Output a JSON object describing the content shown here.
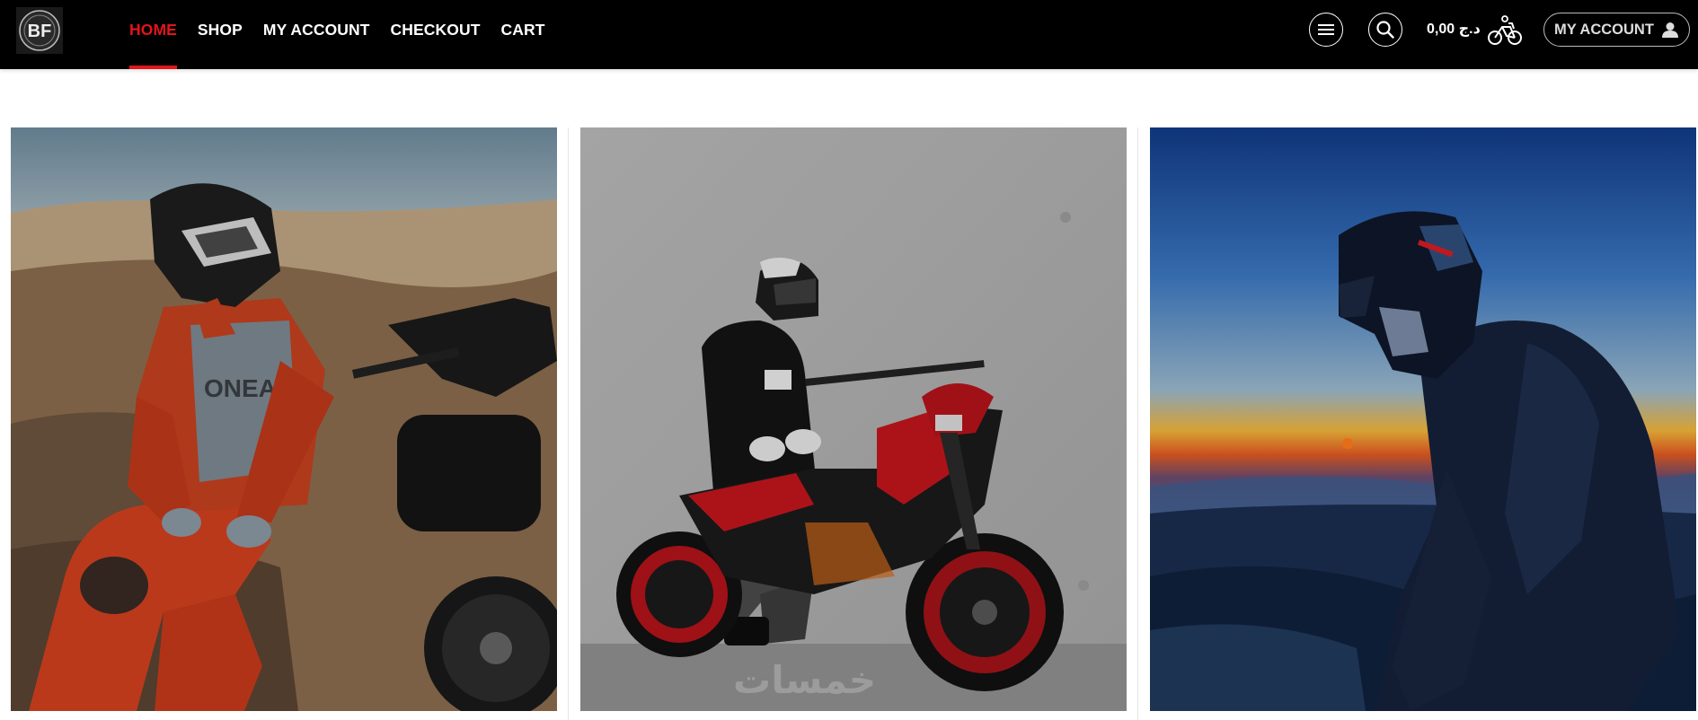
{
  "header": {
    "logo_text": "BF",
    "nav": [
      {
        "label": "HOME",
        "active": true
      },
      {
        "label": "SHOP",
        "active": false
      },
      {
        "label": "MY ACCOUNT",
        "active": false
      },
      {
        "label": "CHECKOUT",
        "active": false
      },
      {
        "label": "CART",
        "active": false
      }
    ],
    "menu_icon": "hamburger-icon",
    "search_icon": "search-icon",
    "cart_total": "0,00 د.ج",
    "cart_icon": "bike-cart-icon",
    "account_label": "MY ACCOUNT",
    "account_icon": "user-icon"
  },
  "gallery": {
    "images": [
      {
        "description_name": "rider-orange-gear-desert"
      },
      {
        "description_name": "rider-black-hoodie-red-ktm"
      },
      {
        "description_name": "rider-helmet-sunset"
      }
    ],
    "watermark": "خمسات"
  },
  "colors": {
    "accent": "#e3151a",
    "header_bg": "#000000",
    "page_bg": "#ffffff"
  }
}
